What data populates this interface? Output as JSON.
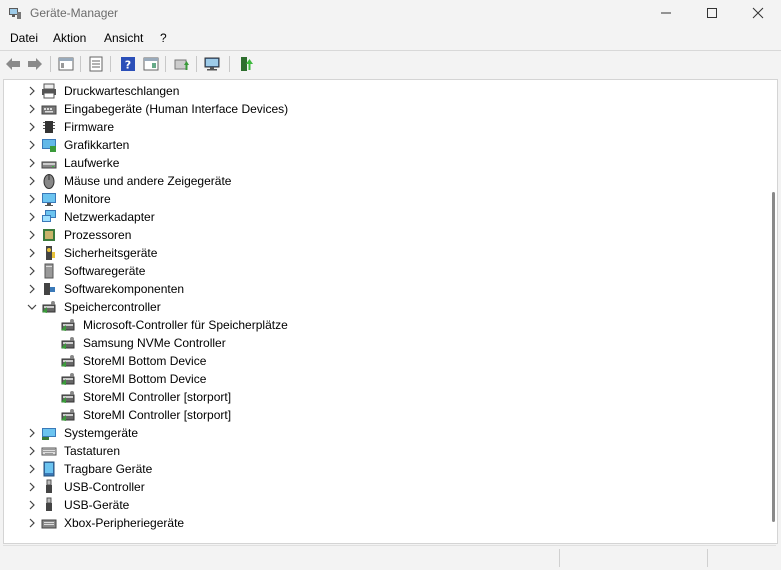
{
  "window": {
    "title": "Geräte-Manager"
  },
  "menu": [
    {
      "label": "Datei"
    },
    {
      "label": "Aktion"
    },
    {
      "label": "Ansicht"
    },
    {
      "label": "?"
    }
  ],
  "toolbar": [
    {
      "icon": "back-arrow-icon"
    },
    {
      "icon": "forward-arrow-icon"
    },
    {
      "icon": "properties-panel-icon"
    },
    {
      "icon": "list-view-icon"
    },
    {
      "icon": "help-icon"
    },
    {
      "icon": "details-view-icon"
    },
    {
      "icon": "update-driver-icon"
    },
    {
      "icon": "scan-hardware-icon"
    },
    {
      "icon": "add-device-icon"
    }
  ],
  "tree": [
    {
      "label": "Druckwarteschlangen",
      "icon": "printer-icon",
      "expanded": false,
      "level": 0
    },
    {
      "label": "Eingabegeräte (Human Interface Devices)",
      "icon": "hid-icon",
      "expanded": false,
      "level": 0
    },
    {
      "label": "Firmware",
      "icon": "firmware-icon",
      "expanded": false,
      "level": 0
    },
    {
      "label": "Grafikkarten",
      "icon": "graphics-card-icon",
      "expanded": false,
      "level": 0
    },
    {
      "label": "Laufwerke",
      "icon": "drive-icon",
      "expanded": false,
      "level": 0
    },
    {
      "label": "Mäuse und andere Zeigegeräte",
      "icon": "mouse-icon",
      "expanded": false,
      "level": 0
    },
    {
      "label": "Monitore",
      "icon": "monitor-icon",
      "expanded": false,
      "level": 0
    },
    {
      "label": "Netzwerkadapter",
      "icon": "network-adapter-icon",
      "expanded": false,
      "level": 0
    },
    {
      "label": "Prozessoren",
      "icon": "processor-icon",
      "expanded": false,
      "level": 0
    },
    {
      "label": "Sicherheitsgeräte",
      "icon": "security-icon",
      "expanded": false,
      "level": 0
    },
    {
      "label": "Softwaregeräte",
      "icon": "software-device-icon",
      "expanded": false,
      "level": 0
    },
    {
      "label": "Softwarekomponenten",
      "icon": "software-component-icon",
      "expanded": false,
      "level": 0
    },
    {
      "label": "Speichercontroller",
      "icon": "storage-controller-icon",
      "expanded": true,
      "level": 0
    },
    {
      "label": "Microsoft-Controller für Speicherplätze",
      "icon": "storage-controller-icon",
      "level": 1
    },
    {
      "label": "Samsung NVMe Controller",
      "icon": "storage-controller-icon",
      "level": 1
    },
    {
      "label": "StoreMI Bottom Device",
      "icon": "storage-controller-icon",
      "level": 1
    },
    {
      "label": "StoreMI Bottom Device",
      "icon": "storage-controller-icon",
      "level": 1
    },
    {
      "label": "StoreMI Controller [storport]",
      "icon": "storage-controller-icon",
      "level": 1
    },
    {
      "label": "StoreMI Controller [storport]",
      "icon": "storage-controller-icon",
      "level": 1
    },
    {
      "label": "Systemgeräte",
      "icon": "system-device-icon",
      "expanded": false,
      "level": 0
    },
    {
      "label": "Tastaturen",
      "icon": "keyboard-icon",
      "expanded": false,
      "level": 0
    },
    {
      "label": "Tragbare Geräte",
      "icon": "portable-device-icon",
      "expanded": false,
      "level": 0
    },
    {
      "label": "USB-Controller",
      "icon": "usb-icon",
      "expanded": false,
      "level": 0
    },
    {
      "label": "USB-Geräte",
      "icon": "usb-icon",
      "expanded": false,
      "level": 0
    },
    {
      "label": "Xbox-Peripheriegeräte",
      "icon": "xbox-peripheral-icon",
      "expanded": false,
      "level": 0
    }
  ]
}
